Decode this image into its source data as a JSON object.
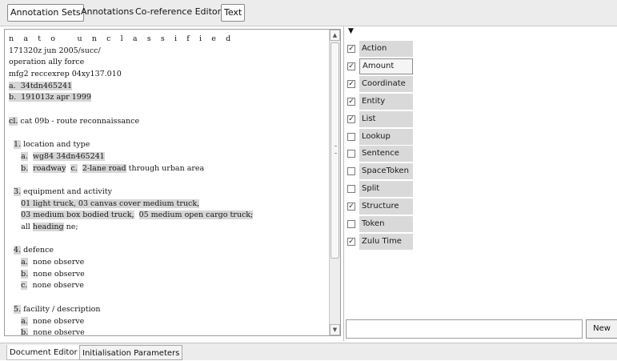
{
  "top_tabs": [
    "Annotation Sets",
    "Annotations",
    "Co-reference Editor",
    "Text"
  ],
  "document": {
    "lines": [
      [
        {
          "t": "n a t o   u n c l a s s i f i e d",
          "cls": "spaced"
        }
      ],
      [
        {
          "t": "171320z jun 2005/succ/"
        }
      ],
      [
        {
          "t": "operation ally force"
        }
      ],
      [
        {
          "t": "mfg2 reccexrep 04xy137.010"
        }
      ],
      [
        {
          "t": "a.",
          "hl": true
        },
        {
          "t": "  34tdn465241",
          "hl": true
        }
      ],
      [
        {
          "t": "b.",
          "hl": true
        },
        {
          "t": "  191013z apr 1999",
          "hl": true
        }
      ],
      [
        {
          "t": ""
        }
      ],
      [
        {
          "t": "cl.",
          "hl": true
        },
        {
          "t": " cat 09b - route reconnaissance"
        }
      ],
      [
        {
          "t": ""
        }
      ],
      [
        {
          "t": "  "
        },
        {
          "t": "1.",
          "hl": true
        },
        {
          "t": " location and type"
        }
      ],
      [
        {
          "t": "     "
        },
        {
          "t": "a.",
          "hl": true
        },
        {
          "t": "  "
        },
        {
          "t": "wg84 34dn465241",
          "hl": true
        }
      ],
      [
        {
          "t": "     "
        },
        {
          "t": "b.",
          "hl": true
        },
        {
          "t": "  "
        },
        {
          "t": "roadway",
          "hl": true
        },
        {
          "t": "  "
        },
        {
          "t": "c.",
          "hl": true
        },
        {
          "t": "  "
        },
        {
          "t": "2-lane road",
          "hl": true
        },
        {
          "t": " through urban area"
        }
      ],
      [
        {
          "t": ""
        }
      ],
      [
        {
          "t": "  "
        },
        {
          "t": "3.",
          "hl": true
        },
        {
          "t": " equipment and activity"
        }
      ],
      [
        {
          "t": "     "
        },
        {
          "t": "01 light truck, 03 canvas cover medium truck,",
          "hl": true
        }
      ],
      [
        {
          "t": "     "
        },
        {
          "t": "03 medium box bodied truck,",
          "hl": true
        },
        {
          "t": "  "
        },
        {
          "t": "05 medium open cargo truck;",
          "hl": true
        }
      ],
      [
        {
          "t": "     all "
        },
        {
          "t": "heading",
          "hl": true
        },
        {
          "t": " ne;"
        }
      ],
      [
        {
          "t": ""
        }
      ],
      [
        {
          "t": "  "
        },
        {
          "t": "4.",
          "hl": true
        },
        {
          "t": " defence"
        }
      ],
      [
        {
          "t": "     "
        },
        {
          "t": "a.",
          "hl": true
        },
        {
          "t": "  none observe"
        }
      ],
      [
        {
          "t": "     "
        },
        {
          "t": "b.",
          "hl": true
        },
        {
          "t": "  none observe"
        }
      ],
      [
        {
          "t": "     "
        },
        {
          "t": "c.",
          "hl": true
        },
        {
          "t": "  none observe"
        }
      ],
      [
        {
          "t": ""
        }
      ],
      [
        {
          "t": "  "
        },
        {
          "t": "5.",
          "hl": true
        },
        {
          "t": " facility / description"
        }
      ],
      [
        {
          "t": "     "
        },
        {
          "t": "a.",
          "hl": true
        },
        {
          "t": "  none observe"
        }
      ],
      [
        {
          "t": "     "
        },
        {
          "t": "b.",
          "hl": true
        },
        {
          "t": "  none observe"
        }
      ]
    ]
  },
  "annotation_types": [
    {
      "label": "Action",
      "checked": true,
      "style": "sel"
    },
    {
      "label": "Amount",
      "checked": true,
      "style": "outlined"
    },
    {
      "label": "Coordinate",
      "checked": true,
      "style": "sel"
    },
    {
      "label": "Entity",
      "checked": true,
      "style": "sel"
    },
    {
      "label": "List",
      "checked": true,
      "style": "sel"
    },
    {
      "label": "Lookup",
      "checked": false,
      "style": "sel"
    },
    {
      "label": "Sentence",
      "checked": false,
      "style": "sel"
    },
    {
      "label": "SpaceToken",
      "checked": false,
      "style": "sel"
    },
    {
      "label": "Split",
      "checked": false,
      "style": "sel"
    },
    {
      "label": "Structure",
      "checked": true,
      "style": "sel"
    },
    {
      "label": "Token",
      "checked": false,
      "style": "sel"
    },
    {
      "label": "Zulu Time",
      "checked": true,
      "style": "sel"
    }
  ],
  "new_type": {
    "value": "",
    "button_label": "New"
  },
  "bottom_tabs": [
    "Document Editor",
    "Initialisation Parameters"
  ],
  "icons": {
    "collapse": "triangle-down-icon",
    "scroll_up": "arrow-up-icon",
    "scroll_down": "arrow-down-icon"
  }
}
